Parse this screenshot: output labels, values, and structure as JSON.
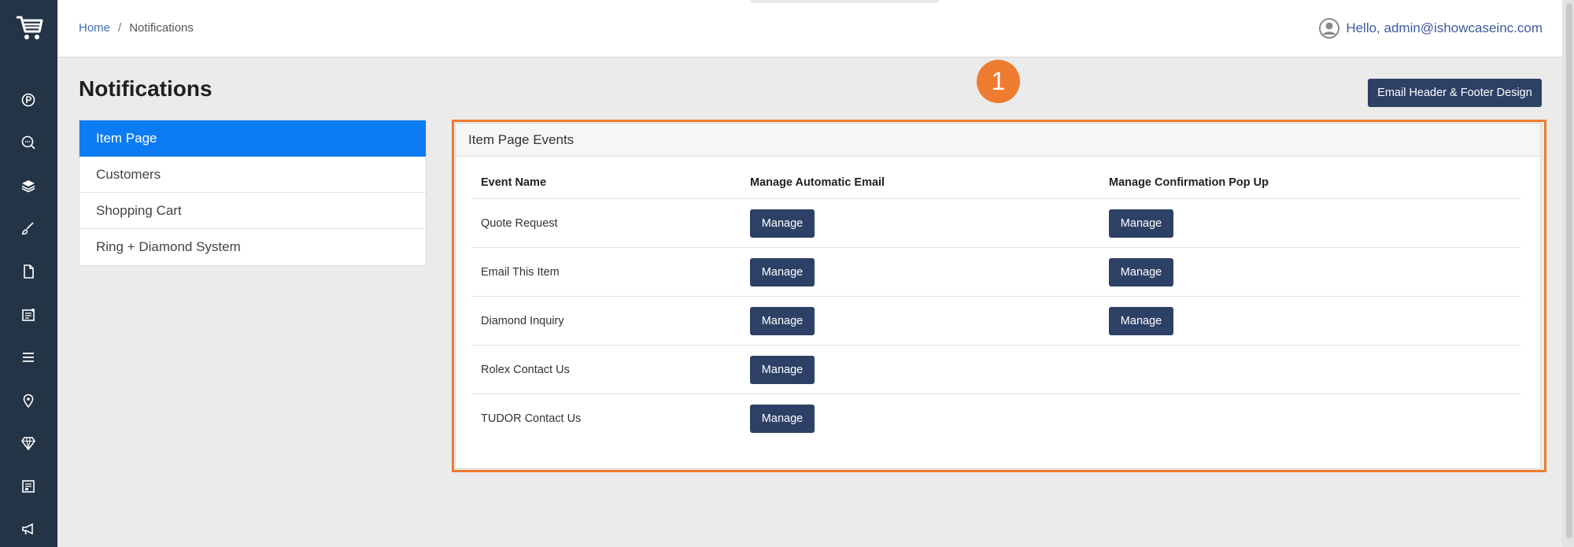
{
  "breadcrumb": {
    "home": "Home",
    "separator": "/",
    "current": "Notifications"
  },
  "user": {
    "greeting": "Hello, admin@ishowcaseinc.com"
  },
  "page": {
    "title": "Notifications"
  },
  "header_button": {
    "label": "Email Header & Footer Design"
  },
  "badge": {
    "number": "1",
    "color": "#ee7b30"
  },
  "side_menu": {
    "items": [
      {
        "label": "Item Page",
        "active": true
      },
      {
        "label": "Customers",
        "active": false
      },
      {
        "label": "Shopping Cart",
        "active": false
      },
      {
        "label": "Ring + Diamond System",
        "active": false
      }
    ]
  },
  "panel": {
    "title": "Item Page Events",
    "columns": [
      "Event Name",
      "Manage Automatic Email",
      "Manage Confirmation Pop Up"
    ],
    "rows": [
      {
        "name": "Quote Request",
        "email_button": "Manage",
        "popup_button": "Manage"
      },
      {
        "name": "Email This Item",
        "email_button": "Manage",
        "popup_button": "Manage"
      },
      {
        "name": "Diamond Inquiry",
        "email_button": "Manage",
        "popup_button": "Manage"
      },
      {
        "name": "Rolex Contact Us",
        "email_button": "Manage",
        "popup_button": ""
      },
      {
        "name": "TUDOR Contact Us",
        "email_button": "Manage",
        "popup_button": ""
      }
    ]
  },
  "rail_icons": [
    "cart-logo-icon",
    "parking-icon",
    "seo-search-icon",
    "layers-icon",
    "brush-icon",
    "document-icon",
    "news-icon",
    "menu-icon",
    "location-pin-icon",
    "diamond-icon",
    "settings-panel-icon",
    "megaphone-icon"
  ],
  "colors": {
    "rail": "#243447",
    "primary_button": "#2d4066",
    "active_menu": "#0d7bf2",
    "highlight": "#ee7b30"
  }
}
